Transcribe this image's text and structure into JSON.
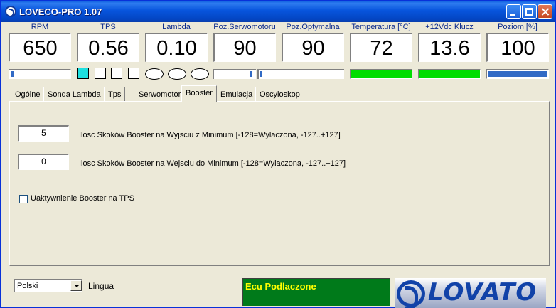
{
  "window": {
    "title": "LOVECO-PRO 1.07"
  },
  "gauges": [
    {
      "label": "RPM",
      "value": "650"
    },
    {
      "label": "TPS",
      "value": "0.56"
    },
    {
      "label": "Lambda",
      "value": "0.10"
    },
    {
      "label": "Poz.Serwomotoru",
      "value": "90"
    },
    {
      "label": "Poz.Optymalna",
      "value": "90"
    },
    {
      "label": "Temperatura [°C]",
      "value": "72"
    },
    {
      "label": "+12Vdc Klucz",
      "value": "13.6"
    },
    {
      "label": "Poziom [%]",
      "value": "100"
    }
  ],
  "indicators": {
    "rpm_bar_fill_pct": 6,
    "poziom_bar_fill_pct": 100,
    "temperatura_status_color": "#00DD00",
    "klucz_status_color": "#00DD00",
    "led_squares": [
      true,
      false,
      false,
      false
    ],
    "led_ovals": [
      false,
      false,
      false
    ]
  },
  "tabs": [
    {
      "label": "Ogólne",
      "active": false
    },
    {
      "label": "Sonda Lambda",
      "active": false
    },
    {
      "label": "Tps",
      "active": false
    },
    {
      "label": "Serwomotor",
      "active": false
    },
    {
      "label": "Booster",
      "active": true
    },
    {
      "label": "Emulacja",
      "active": false
    },
    {
      "label": "Oscyloskop",
      "active": false
    }
  ],
  "booster": {
    "field1": {
      "value": "5",
      "label": "Ilosc Skoków Booster na Wyjsciu z Minimum [-128=Wylaczona, -127..+127]"
    },
    "field2": {
      "value": "0",
      "label": "Ilosc Skoków Booster na Wejsciu do Minimum [-128=Wylaczona, -127..+127]"
    },
    "checkbox": {
      "label": "Uaktywnienie Booster na TPS",
      "checked": false
    }
  },
  "footer": {
    "language_value": "Polski",
    "language_label": "Lingua",
    "status_text": "Ecu Podlaczone",
    "logo_text": "LOVATO"
  },
  "colors": {
    "accent": "#316AC5",
    "status_bg": "#007A1A",
    "status_text": "#FFFF00",
    "logo": "#1142A8"
  }
}
